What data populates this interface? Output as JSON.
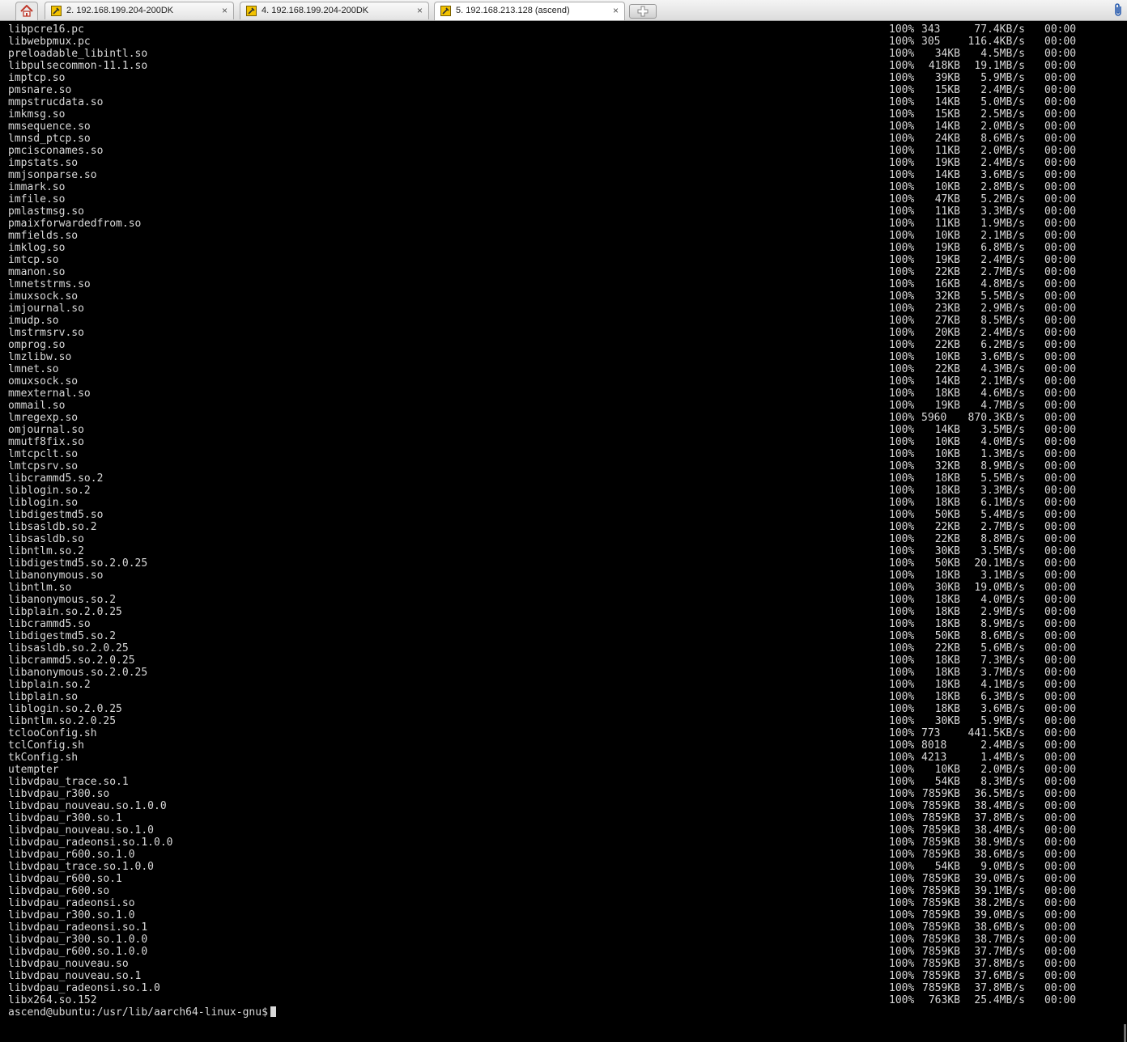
{
  "tabs": [
    {
      "label": "2. 192.168.199.204-200DK",
      "active": false
    },
    {
      "label": "4. 192.168.199.204-200DK",
      "active": false
    },
    {
      "label": "5. 192.168.213.128 (ascend)",
      "active": true
    }
  ],
  "close_glyph": "×",
  "icons": {
    "home": "home-icon",
    "tab": "wrench-icon",
    "new_tab": "plus-icon",
    "attach": "paperclip-icon"
  },
  "rows": [
    [
      "libpcre16.pc",
      "100%",
      "343",
      "77.4KB/s",
      "00:00"
    ],
    [
      "libwebpmux.pc",
      "100%",
      "305",
      "116.4KB/s",
      "00:00"
    ],
    [
      "preloadable_libintl.so",
      "100%",
      "34KB",
      "4.5MB/s",
      "00:00"
    ],
    [
      "libpulsecommon-11.1.so",
      "100%",
      "418KB",
      "19.1MB/s",
      "00:00"
    ],
    [
      "imptcp.so",
      "100%",
      "39KB",
      "5.9MB/s",
      "00:00"
    ],
    [
      "pmsnare.so",
      "100%",
      "15KB",
      "2.4MB/s",
      "00:00"
    ],
    [
      "mmpstrucdata.so",
      "100%",
      "14KB",
      "5.0MB/s",
      "00:00"
    ],
    [
      "imkmsg.so",
      "100%",
      "15KB",
      "2.5MB/s",
      "00:00"
    ],
    [
      "mmsequence.so",
      "100%",
      "14KB",
      "2.0MB/s",
      "00:00"
    ],
    [
      "lmnsd_ptcp.so",
      "100%",
      "24KB",
      "8.6MB/s",
      "00:00"
    ],
    [
      "pmcisconames.so",
      "100%",
      "11KB",
      "2.0MB/s",
      "00:00"
    ],
    [
      "impstats.so",
      "100%",
      "19KB",
      "2.4MB/s",
      "00:00"
    ],
    [
      "mmjsonparse.so",
      "100%",
      "14KB",
      "3.6MB/s",
      "00:00"
    ],
    [
      "immark.so",
      "100%",
      "10KB",
      "2.8MB/s",
      "00:00"
    ],
    [
      "imfile.so",
      "100%",
      "47KB",
      "5.2MB/s",
      "00:00"
    ],
    [
      "pmlastmsg.so",
      "100%",
      "11KB",
      "3.3MB/s",
      "00:00"
    ],
    [
      "pmaixforwardedfrom.so",
      "100%",
      "11KB",
      "1.9MB/s",
      "00:00"
    ],
    [
      "mmfields.so",
      "100%",
      "10KB",
      "2.1MB/s",
      "00:00"
    ],
    [
      "imklog.so",
      "100%",
      "19KB",
      "6.8MB/s",
      "00:00"
    ],
    [
      "imtcp.so",
      "100%",
      "19KB",
      "2.4MB/s",
      "00:00"
    ],
    [
      "mmanon.so",
      "100%",
      "22KB",
      "2.7MB/s",
      "00:00"
    ],
    [
      "lmnetstrms.so",
      "100%",
      "16KB",
      "4.8MB/s",
      "00:00"
    ],
    [
      "imuxsock.so",
      "100%",
      "32KB",
      "5.5MB/s",
      "00:00"
    ],
    [
      "imjournal.so",
      "100%",
      "23KB",
      "2.9MB/s",
      "00:00"
    ],
    [
      "imudp.so",
      "100%",
      "27KB",
      "8.5MB/s",
      "00:00"
    ],
    [
      "lmstrmsrv.so",
      "100%",
      "20KB",
      "2.4MB/s",
      "00:00"
    ],
    [
      "omprog.so",
      "100%",
      "22KB",
      "6.2MB/s",
      "00:00"
    ],
    [
      "lmzlibw.so",
      "100%",
      "10KB",
      "3.6MB/s",
      "00:00"
    ],
    [
      "lmnet.so",
      "100%",
      "22KB",
      "4.3MB/s",
      "00:00"
    ],
    [
      "omuxsock.so",
      "100%",
      "14KB",
      "2.1MB/s",
      "00:00"
    ],
    [
      "mmexternal.so",
      "100%",
      "18KB",
      "4.6MB/s",
      "00:00"
    ],
    [
      "ommail.so",
      "100%",
      "19KB",
      "4.7MB/s",
      "00:00"
    ],
    [
      "lmregexp.so",
      "100%",
      "5960",
      "870.3KB/s",
      "00:00"
    ],
    [
      "omjournal.so",
      "100%",
      "14KB",
      "3.5MB/s",
      "00:00"
    ],
    [
      "mmutf8fix.so",
      "100%",
      "10KB",
      "4.0MB/s",
      "00:00"
    ],
    [
      "lmtcpclt.so",
      "100%",
      "10KB",
      "1.3MB/s",
      "00:00"
    ],
    [
      "lmtcpsrv.so",
      "100%",
      "32KB",
      "8.9MB/s",
      "00:00"
    ],
    [
      "libcrammd5.so.2",
      "100%",
      "18KB",
      "5.5MB/s",
      "00:00"
    ],
    [
      "liblogin.so.2",
      "100%",
      "18KB",
      "3.3MB/s",
      "00:00"
    ],
    [
      "liblogin.so",
      "100%",
      "18KB",
      "6.1MB/s",
      "00:00"
    ],
    [
      "libdigestmd5.so",
      "100%",
      "50KB",
      "5.4MB/s",
      "00:00"
    ],
    [
      "libsasldb.so.2",
      "100%",
      "22KB",
      "2.7MB/s",
      "00:00"
    ],
    [
      "libsasldb.so",
      "100%",
      "22KB",
      "8.8MB/s",
      "00:00"
    ],
    [
      "libntlm.so.2",
      "100%",
      "30KB",
      "3.5MB/s",
      "00:00"
    ],
    [
      "libdigestmd5.so.2.0.25",
      "100%",
      "50KB",
      "20.1MB/s",
      "00:00"
    ],
    [
      "libanonymous.so",
      "100%",
      "18KB",
      "3.1MB/s",
      "00:00"
    ],
    [
      "libntlm.so",
      "100%",
      "30KB",
      "19.0MB/s",
      "00:00"
    ],
    [
      "libanonymous.so.2",
      "100%",
      "18KB",
      "4.0MB/s",
      "00:00"
    ],
    [
      "libplain.so.2.0.25",
      "100%",
      "18KB",
      "2.9MB/s",
      "00:00"
    ],
    [
      "libcrammd5.so",
      "100%",
      "18KB",
      "8.9MB/s",
      "00:00"
    ],
    [
      "libdigestmd5.so.2",
      "100%",
      "50KB",
      "8.6MB/s",
      "00:00"
    ],
    [
      "libsasldb.so.2.0.25",
      "100%",
      "22KB",
      "5.6MB/s",
      "00:00"
    ],
    [
      "libcrammd5.so.2.0.25",
      "100%",
      "18KB",
      "7.3MB/s",
      "00:00"
    ],
    [
      "libanonymous.so.2.0.25",
      "100%",
      "18KB",
      "3.7MB/s",
      "00:00"
    ],
    [
      "libplain.so.2",
      "100%",
      "18KB",
      "4.1MB/s",
      "00:00"
    ],
    [
      "libplain.so",
      "100%",
      "18KB",
      "6.3MB/s",
      "00:00"
    ],
    [
      "liblogin.so.2.0.25",
      "100%",
      "18KB",
      "3.6MB/s",
      "00:00"
    ],
    [
      "libntlm.so.2.0.25",
      "100%",
      "30KB",
      "5.9MB/s",
      "00:00"
    ],
    [
      "tclooConfig.sh",
      "100%",
      "773",
      "441.5KB/s",
      "00:00"
    ],
    [
      "tclConfig.sh",
      "100%",
      "8018",
      "2.4MB/s",
      "00:00"
    ],
    [
      "tkConfig.sh",
      "100%",
      "4213",
      "1.4MB/s",
      "00:00"
    ],
    [
      "utempter",
      "100%",
      "10KB",
      "2.0MB/s",
      "00:00"
    ],
    [
      "libvdpau_trace.so.1",
      "100%",
      "54KB",
      "8.3MB/s",
      "00:00"
    ],
    [
      "libvdpau_r300.so",
      "100%",
      "7859KB",
      "36.5MB/s",
      "00:00"
    ],
    [
      "libvdpau_nouveau.so.1.0.0",
      "100%",
      "7859KB",
      "38.4MB/s",
      "00:00"
    ],
    [
      "libvdpau_r300.so.1",
      "100%",
      "7859KB",
      "37.8MB/s",
      "00:00"
    ],
    [
      "libvdpau_nouveau.so.1.0",
      "100%",
      "7859KB",
      "38.4MB/s",
      "00:00"
    ],
    [
      "libvdpau_radeonsi.so.1.0.0",
      "100%",
      "7859KB",
      "38.9MB/s",
      "00:00"
    ],
    [
      "libvdpau_r600.so.1.0",
      "100%",
      "7859KB",
      "38.6MB/s",
      "00:00"
    ],
    [
      "libvdpau_trace.so.1.0.0",
      "100%",
      "54KB",
      "9.0MB/s",
      "00:00"
    ],
    [
      "libvdpau_r600.so.1",
      "100%",
      "7859KB",
      "39.0MB/s",
      "00:00"
    ],
    [
      "libvdpau_r600.so",
      "100%",
      "7859KB",
      "39.1MB/s",
      "00:00"
    ],
    [
      "libvdpau_radeonsi.so",
      "100%",
      "7859KB",
      "38.2MB/s",
      "00:00"
    ],
    [
      "libvdpau_r300.so.1.0",
      "100%",
      "7859KB",
      "39.0MB/s",
      "00:00"
    ],
    [
      "libvdpau_radeonsi.so.1",
      "100%",
      "7859KB",
      "38.6MB/s",
      "00:00"
    ],
    [
      "libvdpau_r300.so.1.0.0",
      "100%",
      "7859KB",
      "38.7MB/s",
      "00:00"
    ],
    [
      "libvdpau_r600.so.1.0.0",
      "100%",
      "7859KB",
      "37.7MB/s",
      "00:00"
    ],
    [
      "libvdpau_nouveau.so",
      "100%",
      "7859KB",
      "37.8MB/s",
      "00:00"
    ],
    [
      "libvdpau_nouveau.so.1",
      "100%",
      "7859KB",
      "37.6MB/s",
      "00:00"
    ],
    [
      "libvdpau_radeonsi.so.1.0",
      "100%",
      "7859KB",
      "37.8MB/s",
      "00:00"
    ],
    [
      "libx264.so.152",
      "100%",
      "763KB",
      "25.4MB/s",
      "00:00"
    ]
  ],
  "prompt": "ascend@ubuntu:/usr/lib/aarch64-linux-gnu$"
}
